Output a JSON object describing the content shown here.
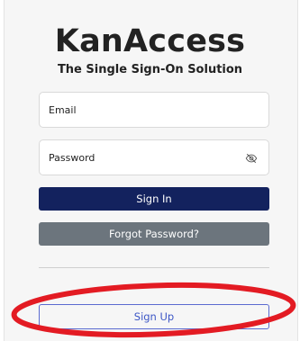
{
  "app": {
    "brand": "KanAccess",
    "tagline": "The Single Sign-On Solution"
  },
  "login_form": {
    "email_placeholder": "Email",
    "password_placeholder": "Password",
    "sign_in_label": "Sign In",
    "forgot_password_label": "Forgot Password?",
    "sign_up_label": "Sign Up",
    "password_toggle_icon": "eye-slash-icon"
  },
  "colors": {
    "primary_button": "#13225e",
    "secondary_button": "#6c757d",
    "outline_button": "#3d57c6",
    "annotation_ellipse": "#e31b23"
  }
}
